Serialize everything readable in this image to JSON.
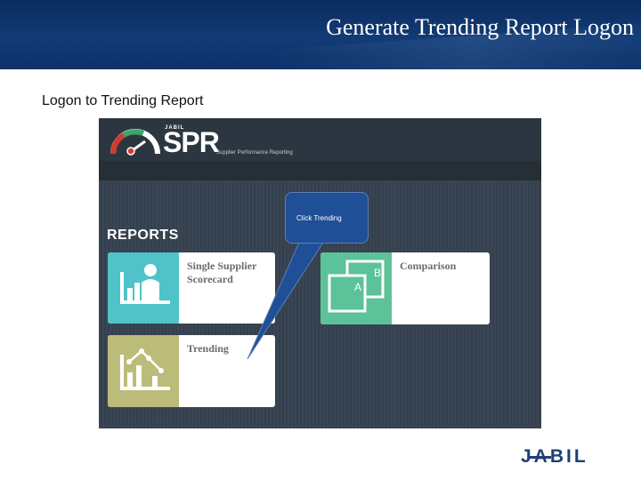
{
  "slide": {
    "title": "Generate Trending Report Logon",
    "subheading": "Logon to Trending Report"
  },
  "app": {
    "logo": {
      "brand_small": "JABIL",
      "product": "SPR",
      "tagline": "Supplier Performance Reporting"
    },
    "reports_heading": "REPORTS",
    "tiles": [
      {
        "label": "Single Supplier Scorecard",
        "icon": "scorecard-icon",
        "color": "#4fc3c8"
      },
      {
        "label": "Comparison",
        "icon": "comparison-icon",
        "color": "#5cc29a",
        "icon_letters": [
          "A",
          "B"
        ]
      },
      {
        "label": "Trending",
        "icon": "trending-chart-icon",
        "color": "#bcbc7a"
      }
    ]
  },
  "callout": {
    "text": "Click  Trending"
  },
  "footer": {
    "logo_text": "JABIL"
  },
  "colors": {
    "banner": "#0a2c5e",
    "callout": "#1f4f96",
    "footer_logo": "#1d3f74"
  }
}
